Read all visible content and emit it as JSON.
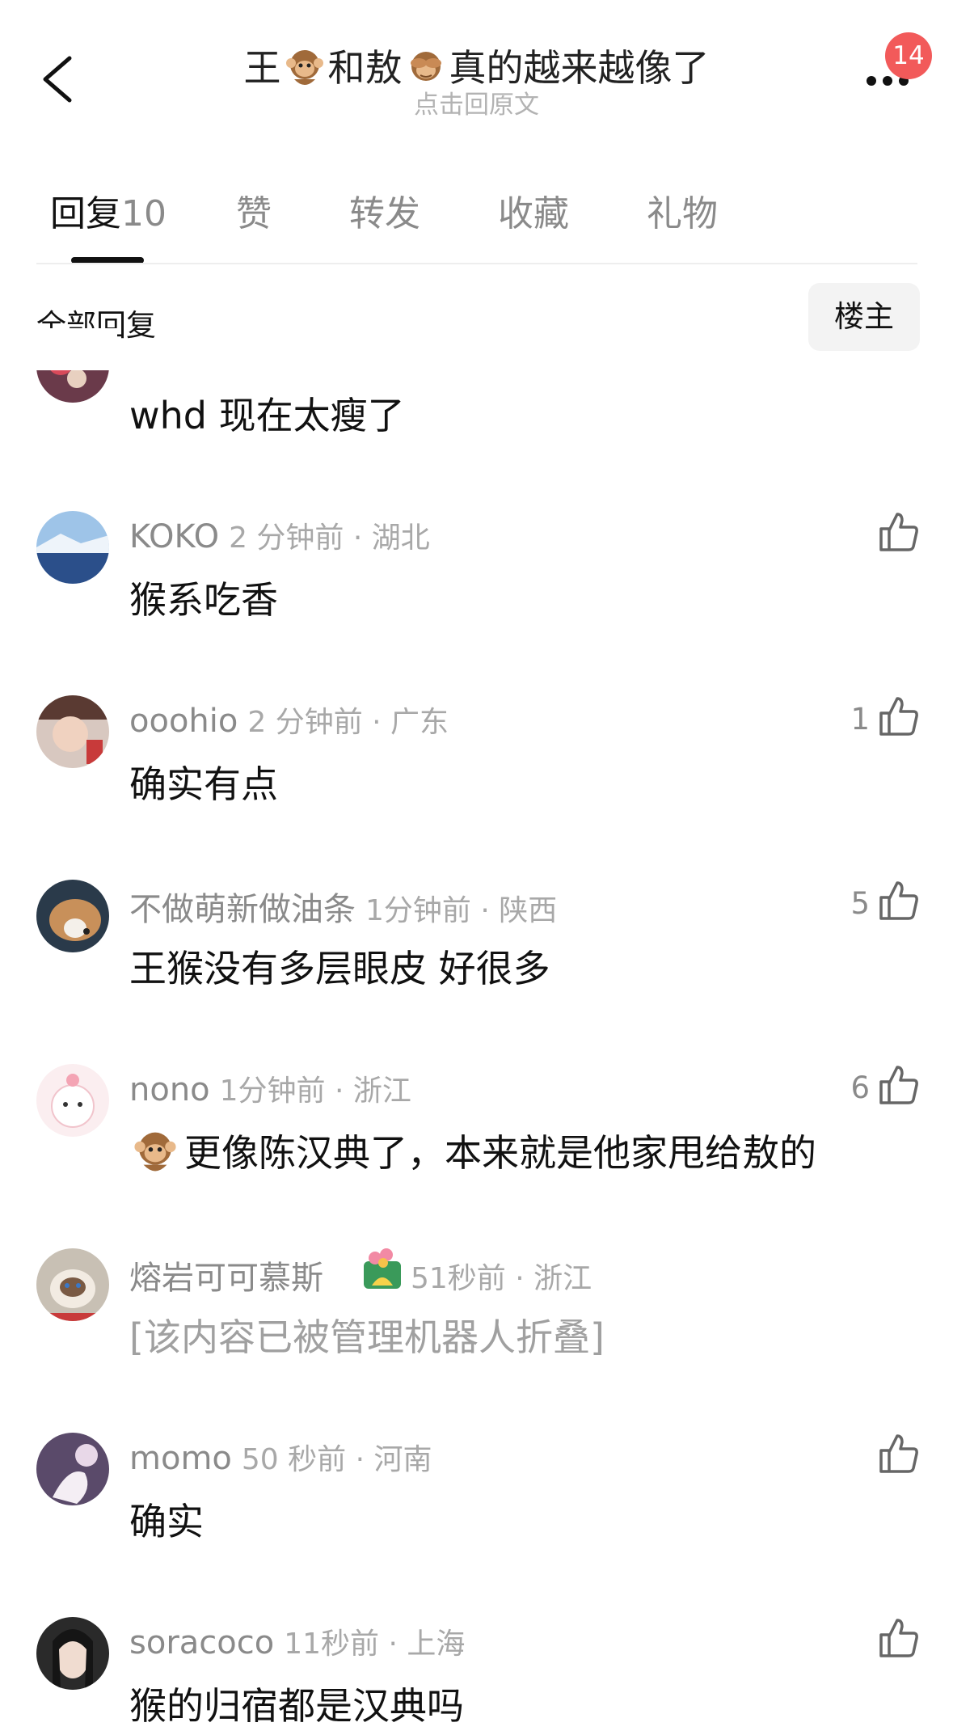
{
  "header": {
    "title_part1": "王",
    "title_part2": "和敖",
    "title_part3": "真的越来越像了",
    "subtitle": "点击回原文",
    "notification_count": "14"
  },
  "tabs": [
    {
      "label": "回复",
      "count": "10"
    },
    {
      "label": "赞"
    },
    {
      "label": "转发"
    },
    {
      "label": "收藏"
    },
    {
      "label": "礼物"
    }
  ],
  "filter": {
    "label": "全部回复",
    "owner_button": "楼主"
  },
  "comments": [
    {
      "text": "whd 现在太瘦了"
    },
    {
      "user": "KOKO",
      "time": "2 分钟前 · 湖北",
      "text": "猴系吃香",
      "likes": ""
    },
    {
      "user": "ooohio",
      "time": "2 分钟前 · 广东",
      "text": "确实有点",
      "likes": "1"
    },
    {
      "user": "不做萌新做油条",
      "time": "1分钟前 · 陕西",
      "text": "王猴没有多层眼皮 好很多",
      "likes": "5"
    },
    {
      "user": "nono",
      "time": "1分钟前 · 浙江",
      "text": "更像陈汉典了，本来就是他家甩给敖的",
      "likes": "6"
    },
    {
      "user": "熔岩可可慕斯",
      "time": "51秒前 · 浙江",
      "text": "[该内容已被管理机器人折叠]"
    },
    {
      "user": "momo",
      "time": "50 秒前 · 河南",
      "text": "确实",
      "likes": ""
    },
    {
      "user": "soracoco",
      "time": "11秒前 · 上海",
      "text": "猴的归宿都是汉典吗",
      "likes": ""
    }
  ],
  "colors": {
    "badge": "#f25a5a",
    "text": "#111111",
    "muted": "#9a9a9a"
  }
}
